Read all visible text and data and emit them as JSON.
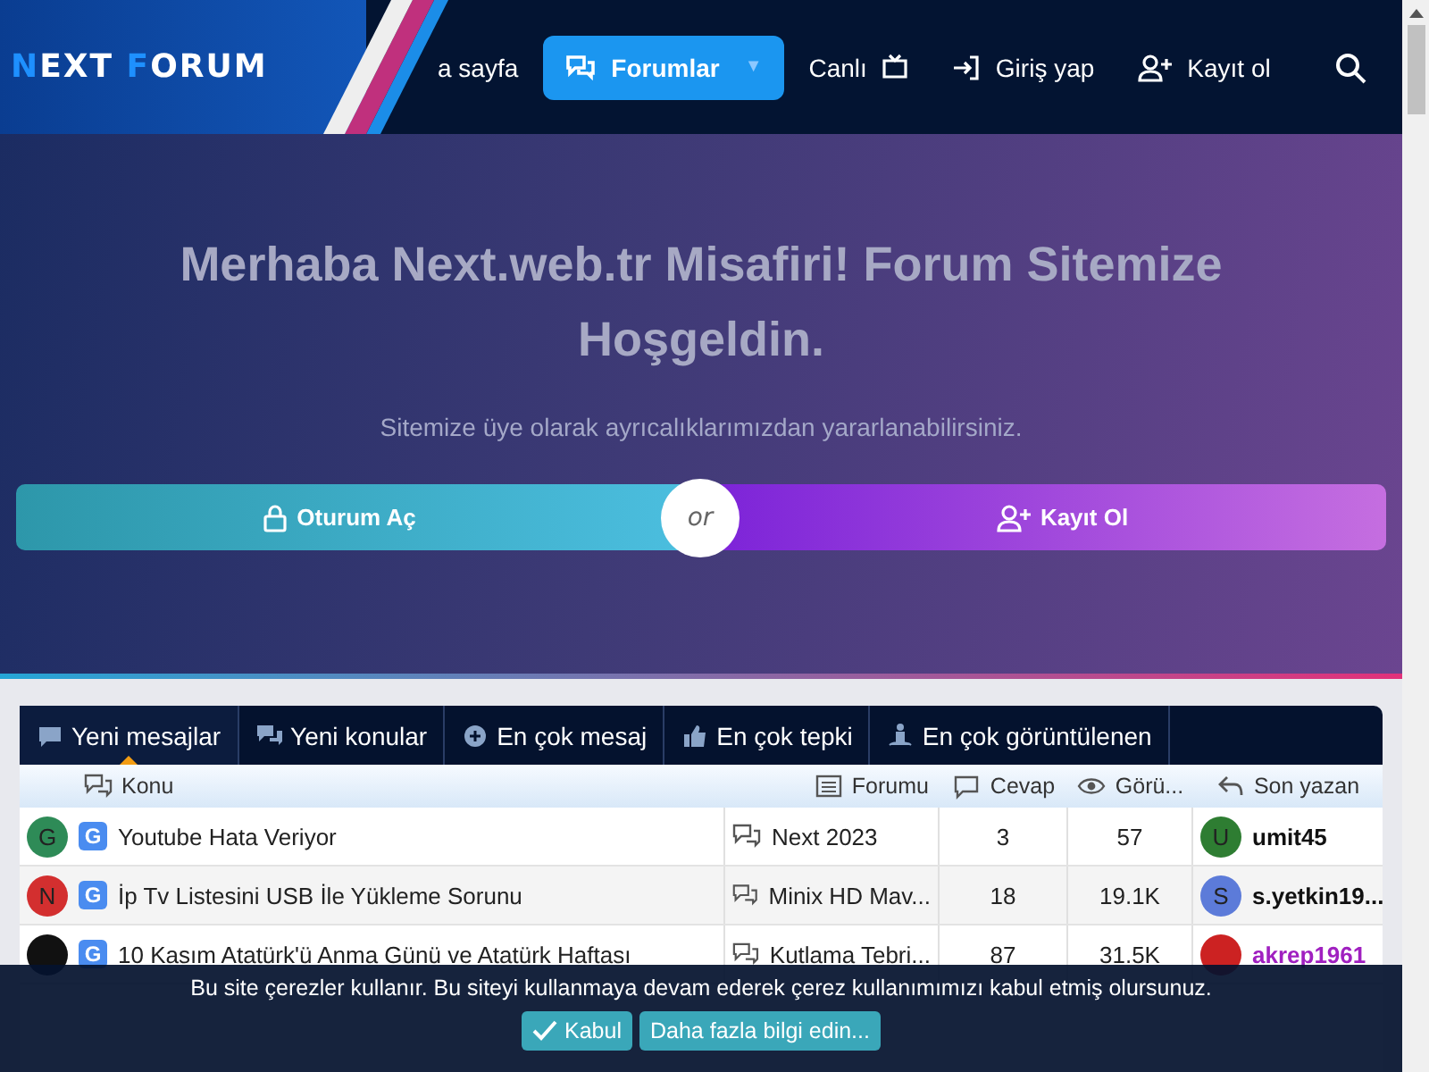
{
  "logo": {
    "first": "N",
    "rest1": "EXT ",
    "second": "F",
    "rest2": "ORUM"
  },
  "nav": [
    {
      "label": "a sayfa",
      "selected": false,
      "kind": "plain"
    },
    {
      "label": "Forumlar",
      "selected": true,
      "kind": "dropdown",
      "caret": "▼"
    },
    {
      "label": "Canlı",
      "selected": false,
      "kind": "plain"
    },
    {
      "label": "Giriş yap",
      "selected": false,
      "kind": "login"
    },
    {
      "label": "Kayıt ol",
      "selected": false,
      "kind": "register"
    }
  ],
  "hero": {
    "title": "Merhaba Next.web.tr Misafiri! Forum Sitemize Hoşgeldin.",
    "subtitle": "Sitemize üye olarak ayrıcalıklarımızdan yararlanabilirsiniz.",
    "login": "Oturum Aç",
    "or": "or",
    "register": "Kayıt Ol"
  },
  "tabs": [
    {
      "label": "Yeni mesajlar",
      "selected": true
    },
    {
      "label": "Yeni konular",
      "selected": false
    },
    {
      "label": "En çok mesaj",
      "selected": false
    },
    {
      "label": "En çok tepki",
      "selected": false
    },
    {
      "label": "En çok görüntülenen",
      "selected": false
    }
  ],
  "table": {
    "columns": [
      "Konu",
      "Forumu",
      "Cevap",
      "Görü...",
      "Son yazan"
    ],
    "rows": [
      {
        "avatar": "G",
        "color": "#2e8b57",
        "prefix": "G",
        "title": "Youtube Hata Veriyor",
        "forum": "Next 2023",
        "replies": "3",
        "views": "57",
        "author": {
          "name": "umit45",
          "avatar": "U",
          "color": "#2e7d32"
        }
      },
      {
        "avatar": "N",
        "color": "#d32f2f",
        "prefix": "G",
        "title": "İp Tv Listesini USB İle Yükleme Sorunu",
        "forum": "Minix HD Mav...",
        "replies": "18",
        "views": "19.1K",
        "author": {
          "name": "s.yetkin19...",
          "avatar": "S",
          "color": "#5c7bd9"
        }
      },
      {
        "color": "#111111",
        "prefix": "G",
        "title": "10 Kasım Atatürk'ü Anma Günü ve Atatürk Haftası",
        "forum": "Kutlama Tebri...",
        "replies": "87",
        "views": "31.5K",
        "author": {
          "name": "akrep1961",
          "color": "#cc2222"
        }
      }
    ]
  },
  "cookie": {
    "text": "Bu site çerezler kullanır. Bu siteyi kullanmaya devam ederek çerez kullanımımızı kabul etmiş olursunuz.",
    "accept": "Kabul",
    "more": "Daha fazla bilgi edin..."
  }
}
